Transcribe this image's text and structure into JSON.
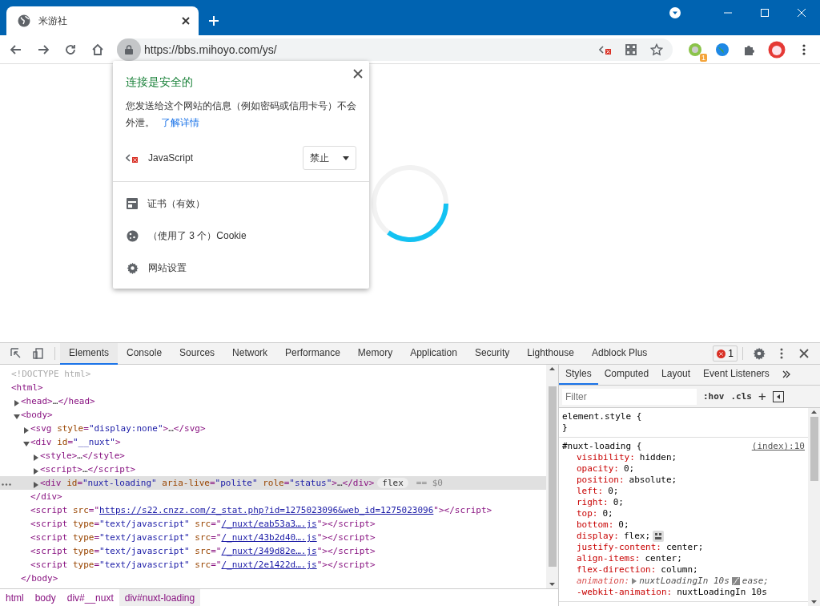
{
  "browser": {
    "tab": {
      "title": "米游社"
    },
    "address": {
      "url": "https://bbs.mihoyo.com/ys/"
    },
    "extension_badge": "1"
  },
  "site_popup": {
    "title": "连接是安全的",
    "description": "您发送给这个网站的信息（例如密码或信用卡号）不会外泄。",
    "learn_more": "了解详情",
    "permission": {
      "label": "JavaScript",
      "value": "禁止"
    },
    "items": [
      {
        "kind": "certificate",
        "label": "证书（有效）"
      },
      {
        "kind": "cookie",
        "label": "（使用了 3 个）Cookie"
      },
      {
        "kind": "settings",
        "label": "网站设置"
      }
    ]
  },
  "devtools": {
    "tabs": [
      {
        "label": "Elements",
        "selected": true
      },
      {
        "label": "Console",
        "selected": false
      },
      {
        "label": "Sources",
        "selected": false
      },
      {
        "label": "Network",
        "selected": false
      },
      {
        "label": "Performance",
        "selected": false
      },
      {
        "label": "Memory",
        "selected": false
      },
      {
        "label": "Application",
        "selected": false
      },
      {
        "label": "Security",
        "selected": false
      },
      {
        "label": "Lighthouse",
        "selected": false
      },
      {
        "label": "Adblock Plus",
        "selected": false
      }
    ],
    "error_count": "1",
    "dom": [
      {
        "selected": false,
        "tokens": [
          {
            "kind": "doctype",
            "text": "<!DOCTYPE html>"
          }
        ]
      },
      {
        "selected": false,
        "tokens": [
          {
            "kind": "tag",
            "text": "<html>"
          }
        ],
        "children": [
          {
            "expanded": false,
            "selected": false,
            "tokens": [
              {
                "kind": "tag",
                "text": "<head>"
              },
              {
                "kind": "plain",
                "text": "…"
              },
              {
                "kind": "tag",
                "text": "</head>"
              }
            ]
          },
          {
            "expanded": true,
            "selected": false,
            "tokens": [
              {
                "kind": "tag",
                "text": "<body>"
              }
            ],
            "children": [
              {
                "expanded": false,
                "selected": false,
                "tokens": [
                  {
                    "kind": "tag",
                    "text": "<svg "
                  },
                  {
                    "kind": "attr",
                    "text": "style"
                  },
                  {
                    "kind": "tag",
                    "text": "="
                  },
                  {
                    "kind": "value",
                    "text": "\"display:none\""
                  },
                  {
                    "kind": "tag",
                    "text": ">"
                  },
                  {
                    "kind": "plain",
                    "text": "…"
                  },
                  {
                    "kind": "tag",
                    "text": "</svg>"
                  }
                ]
              },
              {
                "expanded": true,
                "selected": false,
                "tokens": [
                  {
                    "kind": "tag",
                    "text": "<div "
                  },
                  {
                    "kind": "attr",
                    "text": "id"
                  },
                  {
                    "kind": "tag",
                    "text": "="
                  },
                  {
                    "kind": "value",
                    "text": "\"__nuxt\""
                  },
                  {
                    "kind": "tag",
                    "text": ">"
                  }
                ],
                "children": [
                  {
                    "expanded": false,
                    "selected": false,
                    "tokens": [
                      {
                        "kind": "tag",
                        "text": "<style>"
                      },
                      {
                        "kind": "plain",
                        "text": "…"
                      },
                      {
                        "kind": "tag",
                        "text": "</style>"
                      }
                    ]
                  },
                  {
                    "expanded": false,
                    "selected": false,
                    "tokens": [
                      {
                        "kind": "tag",
                        "text": "<script>"
                      },
                      {
                        "kind": "plain",
                        "text": "…"
                      },
                      {
                        "kind": "tag",
                        "text": "</script>"
                      }
                    ]
                  },
                  {
                    "expanded": false,
                    "selected": true,
                    "badge": "flex",
                    "suffix": "== $0",
                    "tokens": [
                      {
                        "kind": "tag",
                        "text": "<div "
                      },
                      {
                        "kind": "attr",
                        "text": "id"
                      },
                      {
                        "kind": "tag",
                        "text": "="
                      },
                      {
                        "kind": "value",
                        "text": "\"nuxt-loading\""
                      },
                      {
                        "kind": "attr",
                        "text": " aria-live"
                      },
                      {
                        "kind": "tag",
                        "text": "="
                      },
                      {
                        "kind": "value",
                        "text": "\"polite\""
                      },
                      {
                        "kind": "attr",
                        "text": " role"
                      },
                      {
                        "kind": "tag",
                        "text": "="
                      },
                      {
                        "kind": "value",
                        "text": "\"status\""
                      },
                      {
                        "kind": "tag",
                        "text": ">"
                      },
                      {
                        "kind": "plain",
                        "text": "…"
                      },
                      {
                        "kind": "tag",
                        "text": "</div>"
                      }
                    ]
                  }
                ],
                "close": "</div>"
              },
              {
                "selected": false,
                "tokens": [
                  {
                    "kind": "tag",
                    "text": "<script "
                  },
                  {
                    "kind": "attr",
                    "text": "src"
                  },
                  {
                    "kind": "tag",
                    "text": "=\""
                  },
                  {
                    "kind": "link",
                    "text": "https://s22.cnzz.com/z_stat.php?id=1275023096&web_id=1275023096"
                  },
                  {
                    "kind": "tag",
                    "text": "\">"
                  },
                  {
                    "kind": "tag",
                    "text": "</script>"
                  }
                ]
              },
              {
                "selected": false,
                "tokens": [
                  {
                    "kind": "tag",
                    "text": "<script "
                  },
                  {
                    "kind": "attr",
                    "text": "type"
                  },
                  {
                    "kind": "tag",
                    "text": "="
                  },
                  {
                    "kind": "value",
                    "text": "\"text/javascript\""
                  },
                  {
                    "kind": "attr",
                    "text": " src"
                  },
                  {
                    "kind": "tag",
                    "text": "=\""
                  },
                  {
                    "kind": "link",
                    "text": "/_nuxt/eab53a3….js"
                  },
                  {
                    "kind": "tag",
                    "text": "\">"
                  },
                  {
                    "kind": "tag",
                    "text": "</script>"
                  }
                ]
              },
              {
                "selected": false,
                "tokens": [
                  {
                    "kind": "tag",
                    "text": "<script "
                  },
                  {
                    "kind": "attr",
                    "text": "type"
                  },
                  {
                    "kind": "tag",
                    "text": "="
                  },
                  {
                    "kind": "value",
                    "text": "\"text/javascript\""
                  },
                  {
                    "kind": "attr",
                    "text": " src"
                  },
                  {
                    "kind": "tag",
                    "text": "=\""
                  },
                  {
                    "kind": "link",
                    "text": "/_nuxt/43b2d40….js"
                  },
                  {
                    "kind": "tag",
                    "text": "\">"
                  },
                  {
                    "kind": "tag",
                    "text": "</script>"
                  }
                ]
              },
              {
                "selected": false,
                "tokens": [
                  {
                    "kind": "tag",
                    "text": "<script "
                  },
                  {
                    "kind": "attr",
                    "text": "type"
                  },
                  {
                    "kind": "tag",
                    "text": "="
                  },
                  {
                    "kind": "value",
                    "text": "\"text/javascript\""
                  },
                  {
                    "kind": "attr",
                    "text": " src"
                  },
                  {
                    "kind": "tag",
                    "text": "=\""
                  },
                  {
                    "kind": "link",
                    "text": "/_nuxt/349d82e….js"
                  },
                  {
                    "kind": "tag",
                    "text": "\">"
                  },
                  {
                    "kind": "tag",
                    "text": "</script>"
                  }
                ]
              },
              {
                "selected": false,
                "tokens": [
                  {
                    "kind": "tag",
                    "text": "<script "
                  },
                  {
                    "kind": "attr",
                    "text": "type"
                  },
                  {
                    "kind": "tag",
                    "text": "="
                  },
                  {
                    "kind": "value",
                    "text": "\"text/javascript\""
                  },
                  {
                    "kind": "attr",
                    "text": " src"
                  },
                  {
                    "kind": "tag",
                    "text": "=\""
                  },
                  {
                    "kind": "link",
                    "text": "/_nuxt/2e1422d….js"
                  },
                  {
                    "kind": "tag",
                    "text": "\">"
                  },
                  {
                    "kind": "tag",
                    "text": "</script>"
                  }
                ]
              }
            ],
            "close": "</body>"
          }
        ]
      }
    ],
    "breadcrumbs": [
      {
        "label": "html",
        "selected": false
      },
      {
        "label": "body",
        "selected": false
      },
      {
        "label": "div#__nuxt",
        "selected": false
      },
      {
        "label": "div#nuxt-loading",
        "selected": true
      }
    ],
    "sidebar_tabs": [
      {
        "label": "Styles",
        "selected": true
      },
      {
        "label": "Computed",
        "selected": false
      },
      {
        "label": "Layout",
        "selected": false
      },
      {
        "label": "Event Listeners",
        "selected": false
      }
    ],
    "filter": {
      "placeholder": "Filter"
    },
    "hov": ":hov",
    "cls": ".cls",
    "add": "+",
    "rules": [
      {
        "selector": "element.style {",
        "close": "}"
      },
      {
        "selector": "#nuxt-loading {",
        "source": "(index):10",
        "properties": [
          {
            "name": "visibility:",
            "value": "hidden;",
            "struck": false
          },
          {
            "name": "opacity:",
            "value": "0;",
            "struck": false
          },
          {
            "name": "position:",
            "value": "absolute;",
            "struck": false
          },
          {
            "name": "left:",
            "value": "0;",
            "struck": false
          },
          {
            "name": "right:",
            "value": "0;",
            "struck": false
          },
          {
            "name": "top:",
            "value": "0;",
            "struck": false
          },
          {
            "name": "bottom:",
            "value": "0;",
            "struck": false
          },
          {
            "name": "display:",
            "value": "flex;",
            "struck": false,
            "kind": "flex"
          },
          {
            "name": "justify-content:",
            "value": "center;",
            "struck": false
          },
          {
            "name": "align-items:",
            "value": "center;",
            "struck": false
          },
          {
            "name": "flex-direction:",
            "value": "column;",
            "struck": false
          },
          {
            "name": "animation:",
            "value": "nuxtLoadingIn 10s",
            "tail": "ease;",
            "struck": true,
            "kind": "animation"
          },
          {
            "name": "-webkit-animation:",
            "value": "nuxtLoadingIn 10s",
            "struck": false
          }
        ]
      }
    ]
  }
}
